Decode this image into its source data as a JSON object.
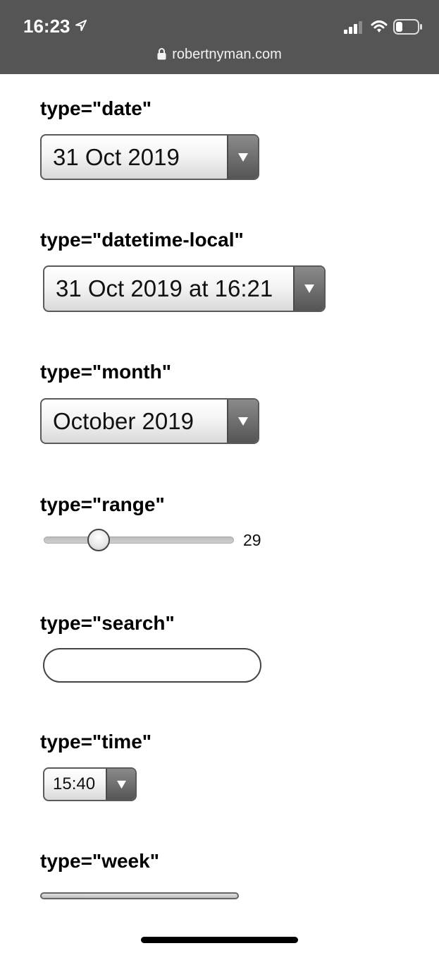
{
  "status_bar": {
    "time": "16:23",
    "url": "robertnyman.com"
  },
  "form": {
    "date": {
      "label": "type=\"date\"",
      "value": "31 Oct 2019"
    },
    "datetime_local": {
      "label": "type=\"datetime-local\"",
      "value": "31 Oct 2019 at 16:21"
    },
    "month": {
      "label": "type=\"month\"",
      "value": "October 2019"
    },
    "range": {
      "label": "type=\"range\"",
      "value": "29",
      "fraction": 0.29
    },
    "search": {
      "label": "type=\"search\"",
      "value": ""
    },
    "time": {
      "label": "type=\"time\"",
      "value": "15:40"
    },
    "week": {
      "label": "type=\"week\"",
      "value": ""
    }
  },
  "colors": {
    "topbar": "#555555",
    "border": "#5a5a5a"
  }
}
